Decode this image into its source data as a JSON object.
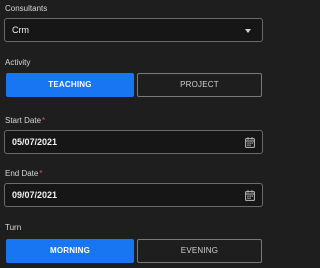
{
  "consultants": {
    "label": "Consultants",
    "selected": "Crm",
    "icon": "chevron-down-icon"
  },
  "activity": {
    "label": "Activity",
    "options": [
      "TEACHING",
      "PROJECT"
    ],
    "selected": "TEACHING"
  },
  "start_date": {
    "label": "Start Date",
    "required_mark": "*",
    "value": "05/07/2021",
    "icon": "calendar-icon"
  },
  "end_date": {
    "label": "End Date",
    "required_mark": "*",
    "value": "09/07/2021",
    "icon": "calendar-icon"
  },
  "turn": {
    "label": "Turn",
    "options": [
      "MORNING",
      "EVENING"
    ],
    "selected": "MORNING"
  },
  "colors": {
    "background": "#1e1e1e",
    "accent": "#1976f2",
    "required": "#e25555"
  }
}
